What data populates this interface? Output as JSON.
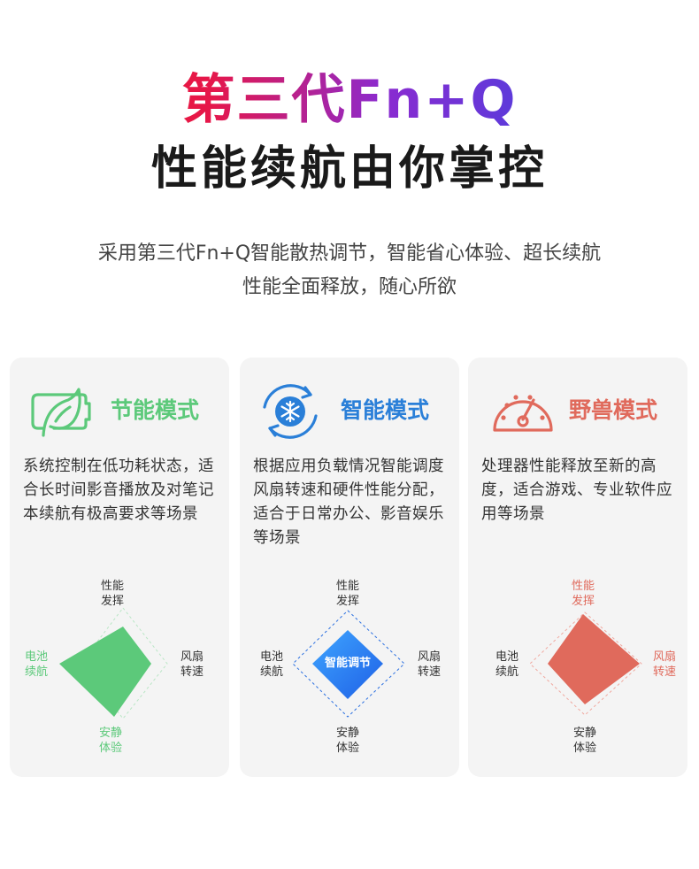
{
  "hero": {
    "title_line1": "第三代Fn+Q",
    "title_line2": "性能续航由你掌控",
    "subtitle_line1": "采用第三代Fn+Q智能散热调节，智能省心体验、超长续航",
    "subtitle_line2": "性能全面释放，随心所欲"
  },
  "modes": [
    {
      "title": "节能模式",
      "icon": "leaf-battery-icon",
      "color": "#5cc97a",
      "description": "系统控制在低功耗状态，适合长时间影音播放及对笔记本续航有极高要求等场景",
      "radar": {
        "top": [
          "性能",
          "发挥"
        ],
        "left": [
          "电池",
          "续航"
        ],
        "right": [
          "风扇",
          "转速"
        ],
        "bottom": [
          "安静",
          "体验"
        ]
      }
    },
    {
      "title": "智能模式",
      "icon": "snowflake-cycle-icon",
      "color": "#2a7fd8",
      "description": "根据应用负载情况智能调度风扇转速和硬件性能分配，适合于日常办公、影音娱乐等场景",
      "center_label": "智能调节",
      "radar": {
        "top": [
          "性能",
          "发挥"
        ],
        "left": [
          "电池",
          "续航"
        ],
        "right": [
          "风扇",
          "转速"
        ],
        "bottom": [
          "安静",
          "体验"
        ]
      }
    },
    {
      "title": "野兽模式",
      "icon": "speedometer-icon",
      "color": "#e06a5c",
      "description": "处理器性能释放至新的高度，适合游戏、专业软件应用等场景",
      "radar": {
        "top": [
          "性能",
          "发挥"
        ],
        "left": [
          "电池",
          "续航"
        ],
        "right": [
          "风扇",
          "转速"
        ],
        "bottom": [
          "安静",
          "体验"
        ]
      }
    }
  ]
}
